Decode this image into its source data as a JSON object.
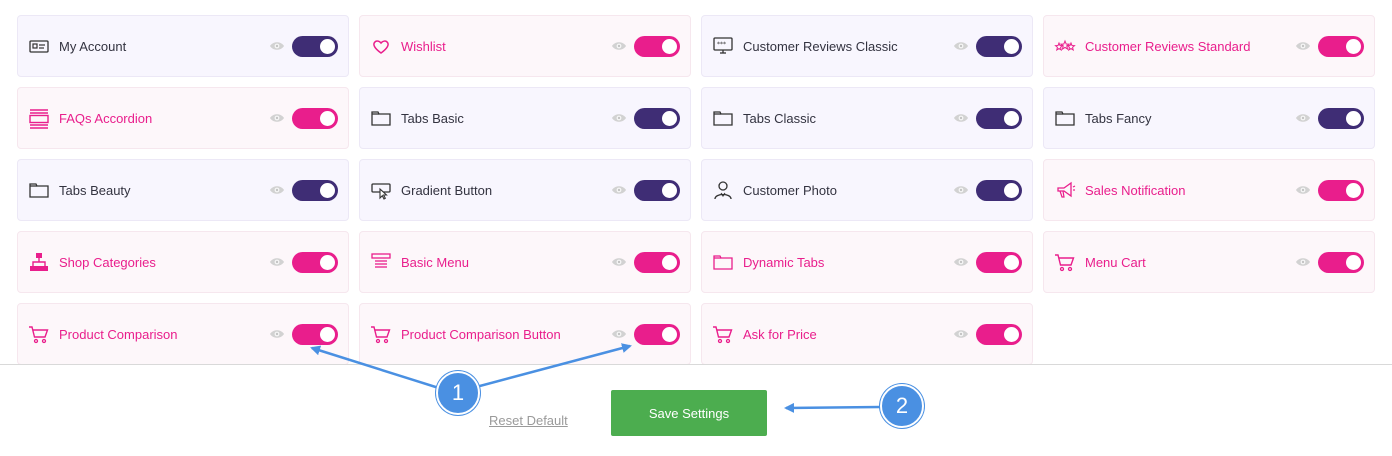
{
  "widgets": [
    {
      "label": "My Account",
      "icon": "account-card-icon",
      "type": "free",
      "toggle": "purple"
    },
    {
      "label": "Wishlist",
      "icon": "heart-icon",
      "type": "pro",
      "toggle": "pink"
    },
    {
      "label": "Customer Reviews Classic",
      "icon": "review-monitor-icon",
      "type": "free",
      "toggle": "purple"
    },
    {
      "label": "Customer Reviews Standard",
      "icon": "stars-icon",
      "type": "pro",
      "toggle": "pink"
    },
    {
      "label": "FAQs Accordion",
      "icon": "accordion-icon",
      "type": "pro",
      "toggle": "pink"
    },
    {
      "label": "Tabs Basic",
      "icon": "tab-window-icon",
      "type": "free",
      "toggle": "purple"
    },
    {
      "label": "Tabs Classic",
      "icon": "tab-window-icon",
      "type": "free",
      "toggle": "purple"
    },
    {
      "label": "Tabs Fancy",
      "icon": "tab-window-icon",
      "type": "free",
      "toggle": "purple"
    },
    {
      "label": "Tabs Beauty",
      "icon": "tab-window-icon",
      "type": "free",
      "toggle": "purple"
    },
    {
      "label": "Gradient Button",
      "icon": "button-cursor-icon",
      "type": "free",
      "toggle": "purple"
    },
    {
      "label": "Customer Photo",
      "icon": "customer-person-icon",
      "type": "free",
      "toggle": "purple"
    },
    {
      "label": "Sales Notification",
      "icon": "megaphone-icon",
      "type": "pro",
      "toggle": "pink"
    },
    {
      "label": "Shop Categories",
      "icon": "sitemap-icon",
      "type": "pro",
      "toggle": "pink"
    },
    {
      "label": "Basic Menu",
      "icon": "menu-icon",
      "type": "pro",
      "toggle": "pink"
    },
    {
      "label": "Dynamic Tabs",
      "icon": "tab-window-icon",
      "type": "pro",
      "toggle": "pink"
    },
    {
      "label": "Menu Cart",
      "icon": "cart-icon",
      "type": "pro",
      "toggle": "pink"
    },
    {
      "label": "Product Comparison",
      "icon": "cart-icon",
      "type": "pro",
      "toggle": "pink"
    },
    {
      "label": "Product Comparison Button",
      "icon": "cart-icon",
      "type": "pro",
      "toggle": "pink"
    },
    {
      "label": "Ask for Price",
      "icon": "cart-icon",
      "type": "pro",
      "toggle": "pink"
    }
  ],
  "footer": {
    "reset_label": "Reset Default",
    "save_label": "Save Settings"
  },
  "callouts": {
    "one": "1",
    "two": "2"
  },
  "colors": {
    "pink": "#e91e8c",
    "purple": "#3f2d75",
    "save_green": "#4cad4f",
    "callout_blue": "#4a90e2"
  }
}
